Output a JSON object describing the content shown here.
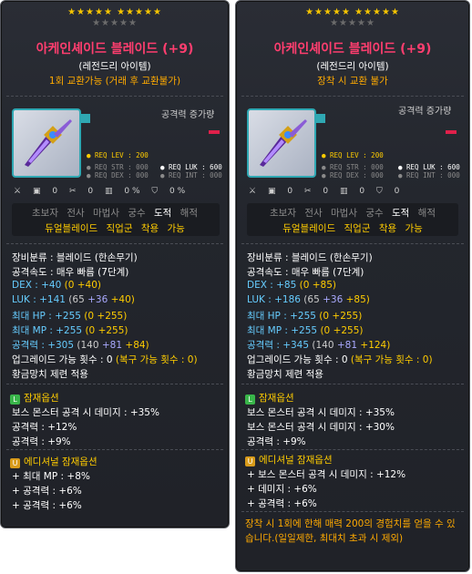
{
  "stars": {
    "filled": 10,
    "empty": 5,
    "star_glyph": "★",
    "colors": {
      "filled": "#f5c400",
      "empty": "#6b6b6b"
    }
  },
  "left": {
    "name": "아케인셰이드 블레이드 (+9)",
    "rarity": "(레전드리 아이템)",
    "trade": "1회 교환가능 (거래 후 교환불가)",
    "attack_increase_label": "공격력 증가량",
    "req": {
      "lev": "● REQ LEV : 200",
      "str": "● REQ STR : 000",
      "dex": "● REQ DEX : 000",
      "luk": "● REQ LUK : 600",
      "int": "● REQ INT : 000"
    },
    "icon_row": [
      "0",
      "0",
      "0 %",
      "0 %"
    ],
    "jobs": {
      "beginner": "초보자",
      "warrior": "전사",
      "mage": "마법사",
      "archer": "궁수",
      "thief": "도적",
      "pirate": "해적"
    },
    "job_note": "듀얼블레이드 직업군 착용 가능",
    "stats": {
      "category": "장비분류 : 블레이드 (한손무기)",
      "speed": "공격속도 : 매우 빠름 (7단계)",
      "dex": {
        "label": "DEX : +40",
        "detail": "(0 +40)"
      },
      "luk": {
        "label": "LUK : +141",
        "base": "(65",
        "plus1": "+36",
        "plus2": "+40)"
      },
      "hp": {
        "label": "최대 HP : +255",
        "detail": "(0 +255)"
      },
      "mp": {
        "label": "최대 MP : +255",
        "detail": "(0 +255)"
      },
      "atk": {
        "label": "공격력 : +305",
        "base": "(140",
        "plus1": "+81",
        "plus2": "+84)"
      },
      "upgrade": "업그레이드 가능 횟수 : 0",
      "upgrade_note": "(복구 가능 횟수 : 0)",
      "hammer": "황금망치 제련 적용"
    },
    "potential_title": "잠재옵션",
    "potential": [
      "보스 몬스터 공격 시 데미지 : +35%",
      "공격력 : +12%",
      "공격력 : +9%"
    ],
    "additional_title": "에디셔널 잠재옵션",
    "additional": [
      "+ 최대 MP : +8%",
      "+ 공격력 : +6%",
      "+ 공격력 : +6%"
    ]
  },
  "right": {
    "name": "아케인셰이드 블레이드 (+9)",
    "rarity": "(레전드리 아이템)",
    "trade": "장착 시 교환 불가",
    "attack_increase_label": "공격력 증가량",
    "req": {
      "lev": "● REQ LEV : 200",
      "str": "● REQ STR : 000",
      "dex": "● REQ DEX : 000",
      "luk": "● REQ LUK : 600",
      "int": "● REQ INT : 000"
    },
    "icon_row": [
      "0",
      "0",
      "0",
      "0"
    ],
    "jobs": {
      "beginner": "초보자",
      "warrior": "전사",
      "mage": "마법사",
      "archer": "궁수",
      "thief": "도적",
      "pirate": "해적"
    },
    "job_note": "듀얼블레이드 직업군 착용 가능",
    "stats": {
      "category": "장비분류 : 블레이드 (한손무기)",
      "speed": "공격속도 : 매우 빠름 (7단계)",
      "dex": {
        "label": "DEX : +85",
        "detail": "(0 +85)"
      },
      "luk": {
        "label": "LUK : +186",
        "base": "(65",
        "plus1": "+36",
        "plus2": "+85)"
      },
      "hp": {
        "label": "최대 HP : +255",
        "detail": "(0 +255)"
      },
      "mp": {
        "label": "최대 MP : +255",
        "detail": "(0 +255)"
      },
      "atk": {
        "label": "공격력 : +345",
        "base": "(140",
        "plus1": "+81",
        "plus2": "+124)"
      },
      "upgrade": "업그레이드 가능 횟수 : 0",
      "upgrade_note": "(복구 가능 횟수 : 0)",
      "hammer": "황금망치 제련 적용"
    },
    "potential_title": "잠재옵션",
    "potential": [
      "보스 몬스터 공격 시 데미지 : +35%",
      "보스 몬스터 공격 시 데미지 : +30%",
      "공격력 : +9%"
    ],
    "additional_title": "에디셔널 잠재옵션",
    "additional": [
      "+ 보스 몬스터 공격 시 데미지 : +12%",
      "+ 데미지 : +6%",
      "+ 공격력 : +6%"
    ],
    "footnote": "장착 시 1회에 한해 매력 200의 경험치를 얻을 수 있습니다.(일일제한, 최대치 초과 시 제외)"
  },
  "colors": {
    "name": "#ff3e6f",
    "trade": "#ffaa00",
    "job_note": "#ffcc00",
    "stat_blue": "#66ccff",
    "frame_accent": "#2fa8b3"
  }
}
